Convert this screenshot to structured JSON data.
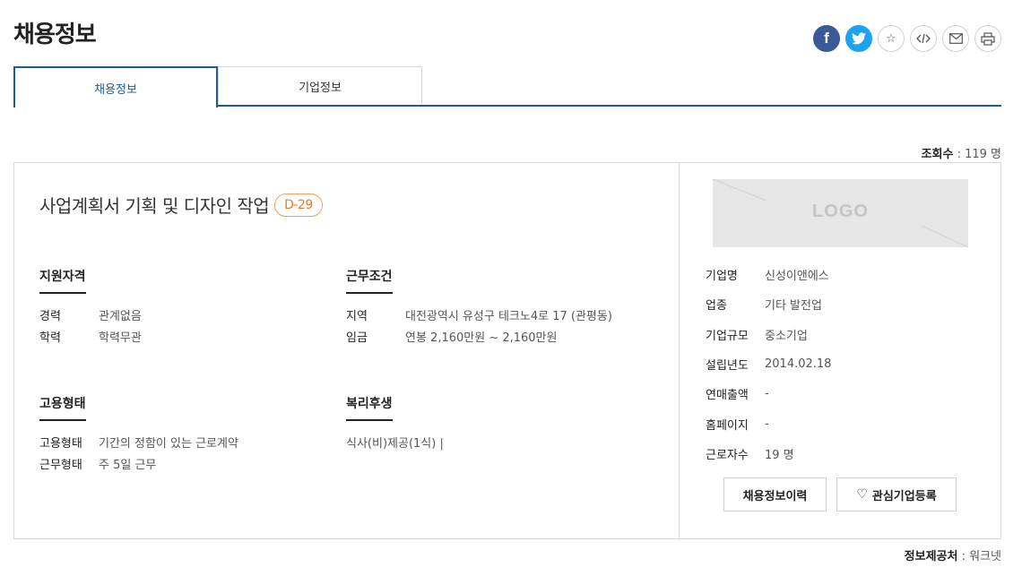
{
  "page": {
    "title": "채용정보"
  },
  "share": {
    "facebook_glyph": "f",
    "twitter_glyph": "🐦",
    "star_glyph": "☆",
    "embed_glyph": "</>",
    "mail_glyph": "✉",
    "print_glyph": "🖶",
    "icons": [
      "facebook-icon",
      "twitter-icon",
      "star-icon",
      "embed-icon",
      "mail-icon",
      "print-icon"
    ]
  },
  "tabs": [
    {
      "label": "채용정보",
      "active": true
    },
    {
      "label": "기업정보",
      "active": false
    }
  ],
  "views": {
    "label": "조회수",
    "value": " : 119 명"
  },
  "job": {
    "title": "사업계획서 기획 및 디자인 작업",
    "dday": "D-29"
  },
  "qualification": {
    "heading": "지원자격",
    "rows": [
      {
        "key": "경력",
        "value": "관계없음"
      },
      {
        "key": "학력",
        "value": "학력무관"
      }
    ]
  },
  "conditions": {
    "heading": "근무조건",
    "rows": [
      {
        "key": "지역",
        "value": "대전광역시 유성구 테크노4로 17 (관평동)"
      },
      {
        "key": "임금",
        "value": "연봉 2,160만원 ~ 2,160만원"
      }
    ]
  },
  "employment": {
    "heading": "고용형태",
    "rows": [
      {
        "key": "고용형태",
        "value": "기간의 정함이 있는 근로계약"
      },
      {
        "key": "근무형태",
        "value": "주 5일 근무"
      }
    ]
  },
  "welfare": {
    "heading": "복리후생",
    "value": "식사(비)제공(1식) |"
  },
  "company": {
    "logo_text": "LOGO",
    "rows": [
      {
        "key": "기업명",
        "value": "신성이앤에스"
      },
      {
        "key": "업종",
        "value": "기타 발전업"
      },
      {
        "key": "기업규모",
        "value": "중소기업"
      },
      {
        "key": "설립년도",
        "value": "2014.02.18"
      },
      {
        "key": "연매출액",
        "value": "-"
      },
      {
        "key": "홈페이지",
        "value": "-"
      },
      {
        "key": "근로자수",
        "value": "19 명"
      }
    ]
  },
  "actions": {
    "history_label": "채용정보이력",
    "favorite_label": "관심기업등록",
    "heart_glyph": "♡"
  },
  "provider": {
    "label": "정보제공처",
    "value": " : 워크넷"
  },
  "colors": {
    "accent": "#1e5b94",
    "dday_border": "#f0a058",
    "facebook": "#3b5998",
    "twitter": "#1da1f2"
  }
}
